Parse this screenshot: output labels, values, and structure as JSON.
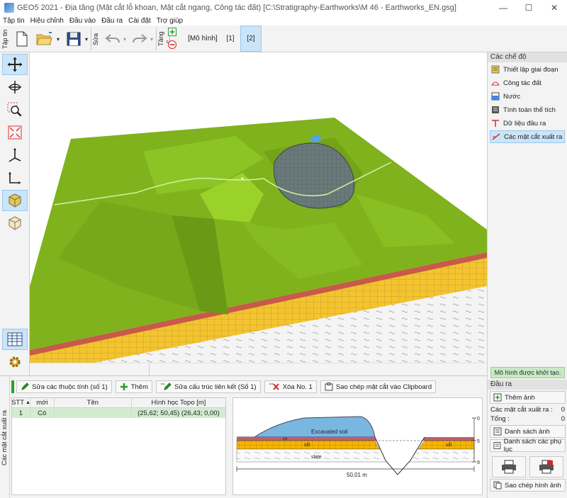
{
  "window": {
    "title": "GEO5 2021 - Địa tầng (Mặt cắt lỗ khoan, Mặt cắt ngang, Công tác đất) [C:\\Stratigraphy-Earthworks\\M 46 - Earthworks_EN.gsg]",
    "minimize": "—",
    "maximize": "☐",
    "close": "✕"
  },
  "menu": [
    "Tập tin",
    "Hiệu chỉnh",
    "Đầu vào",
    "Đầu ra",
    "Cài đặt",
    "Trợ giúp"
  ],
  "toolbar": {
    "file_group_label": "Tập tin",
    "edit_group_label": "Sửa",
    "layers_group_label": "Tầng c...",
    "model_tab": "[Mô hình]",
    "stage1": "[1]",
    "stage2": "[2]"
  },
  "right_panel": {
    "modes_header": "Các chế độ",
    "modes": [
      {
        "label": "Thiết lập giai đoạn",
        "icon": "stage-settings-icon"
      },
      {
        "label": "Công tác đất",
        "icon": "earthworks-icon"
      },
      {
        "label": "Nước",
        "icon": "water-icon"
      },
      {
        "label": "Tính toán thể tích",
        "icon": "volume-calc-icon"
      },
      {
        "label": "Dữ liệu đầu ra",
        "icon": "output-data-icon"
      },
      {
        "label": "Các mặt cắt xuất ra",
        "icon": "output-sections-icon"
      }
    ],
    "status": "Mô hình được khởi tạo.",
    "output_header": "Đầu ra",
    "add_image": "Thêm ảnh",
    "sections_label": "Các mặt cắt xuất ra :",
    "sections_value": "0",
    "total_label": "Tổng :",
    "total_value": "0",
    "image_list": "Danh sách ảnh",
    "appendix_list": "Danh sách các phụ lục",
    "copy_image": "Sao chép hình ảnh"
  },
  "bottom": {
    "side_label": "Các mặt cắt xuất ra",
    "buttons": {
      "edit_props": "Sửa các thuộc tính (số 1)",
      "add": "Thêm",
      "edit_structure": "Sửa cấu trúc liên kết (Số 1)",
      "delete": "Xóa No. 1",
      "copy": "Sao chép mặt cắt vào Clipboard"
    },
    "table": {
      "columns": [
        "STT",
        "mới",
        "Tên",
        "Hình học Topo [m]"
      ],
      "rows": [
        {
          "no": "1",
          "new": "Có",
          "name": "",
          "geometry": "(25,62; 50,45) (26,43; 0,00)"
        }
      ]
    },
    "section": {
      "labels": [
        "Excavated soil",
        "silt",
        "silt",
        "slate",
        "silt"
      ],
      "width_label": "50,01 m",
      "depth_ticks": [
        "0",
        "5",
        "9"
      ]
    }
  },
  "colors": {
    "terrain": "#7fb21c",
    "selection": "#cce4f7",
    "status_green": "#c9e8c2",
    "row_highlight": "#d2ecd0"
  }
}
